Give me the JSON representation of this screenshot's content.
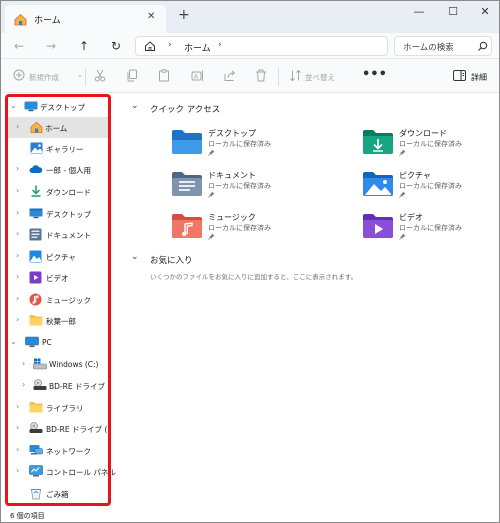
{
  "tab": {
    "title": "ホーム",
    "close_glyph": "✕",
    "new_tab_glyph": "+"
  },
  "window_controls": {
    "minimize": "—",
    "maximize": "☐",
    "close": "✕"
  },
  "address": {
    "path": [
      "ホーム"
    ],
    "search_placeholder": "ホームの検索"
  },
  "toolbar": {
    "new_label": "新規作成",
    "sort_label": "並べ替え",
    "more_label": "•••",
    "details_label": "詳細"
  },
  "sidebar": {
    "items": [
      {
        "label": "デスクトップ",
        "icon": "desktop-icon",
        "chevron": "⌄",
        "expanded": true
      },
      {
        "label": "ホーム",
        "icon": "home-icon",
        "chevron": "›",
        "selected": true
      },
      {
        "label": "ギャラリー",
        "icon": "gallery-icon",
        "chevron": ""
      },
      {
        "label": "一郎 - 個人用",
        "icon": "onedrive-icon",
        "chevron": "›"
      },
      {
        "label": "ダウンロード",
        "icon": "download-icon",
        "chevron": "›"
      },
      {
        "label": "デスクトップ",
        "icon": "desktop-icon",
        "chevron": "›"
      },
      {
        "label": "ドキュメント",
        "icon": "documents-icon",
        "chevron": "›"
      },
      {
        "label": "ピクチャ",
        "icon": "pictures-icon",
        "chevron": "›"
      },
      {
        "label": "ビデオ",
        "icon": "videos-icon",
        "chevron": "›"
      },
      {
        "label": "ミュージック",
        "icon": "music-icon",
        "chevron": "›"
      },
      {
        "label": "秋葉一郎",
        "icon": "folder-icon",
        "chevron": "›"
      },
      {
        "label": "PC",
        "icon": "pc-icon",
        "chevron": "⌄",
        "expanded": true
      },
      {
        "label": "Windows (C:)",
        "icon": "windows-drive-icon",
        "chevron": "›"
      },
      {
        "label": "BD-RE ドライブ (D:",
        "icon": "optical-drive-icon",
        "chevron": "›"
      },
      {
        "label": "ライブラリ",
        "icon": "library-icon",
        "chevron": "›"
      },
      {
        "label": "BD-RE ドライブ (D:)",
        "icon": "optical-drive-icon",
        "chevron": "›"
      },
      {
        "label": "ネットワーク",
        "icon": "network-icon",
        "chevron": "›"
      },
      {
        "label": "コントロール パネル",
        "icon": "control-panel-icon",
        "chevron": "›"
      },
      {
        "label": "ごみ箱",
        "icon": "recycle-bin-icon",
        "chevron": ""
      }
    ]
  },
  "main": {
    "quick_access": {
      "title": "クイック アクセス",
      "items": [
        {
          "name": "デスクトップ",
          "status": "ローカルに保存済み",
          "icon": "desktop-folder-icon"
        },
        {
          "name": "ダウンロード",
          "status": "ローカルに保存済み",
          "icon": "downloads-folder-icon"
        },
        {
          "name": "ドキュメント",
          "status": "ローカルに保存済み",
          "icon": "documents-folder-icon"
        },
        {
          "name": "ピクチャ",
          "status": "ローカルに保存済み",
          "icon": "pictures-folder-icon"
        },
        {
          "name": "ミュージック",
          "status": "ローカルに保存済み",
          "icon": "music-folder-icon"
        },
        {
          "name": "ビデオ",
          "status": "ローカルに保存済み",
          "icon": "videos-folder-icon"
        }
      ]
    },
    "favorites": {
      "title": "お気に入り",
      "empty_message": "いくつかのファイルをお気に入りに追加すると、ここに表示されます。"
    }
  },
  "status_bar": {
    "item_count": "6 個の項目"
  },
  "colors": {
    "highlight_border": "#e8141b",
    "selected_bg": "#e4e4e4",
    "accent": "#0067c0"
  }
}
